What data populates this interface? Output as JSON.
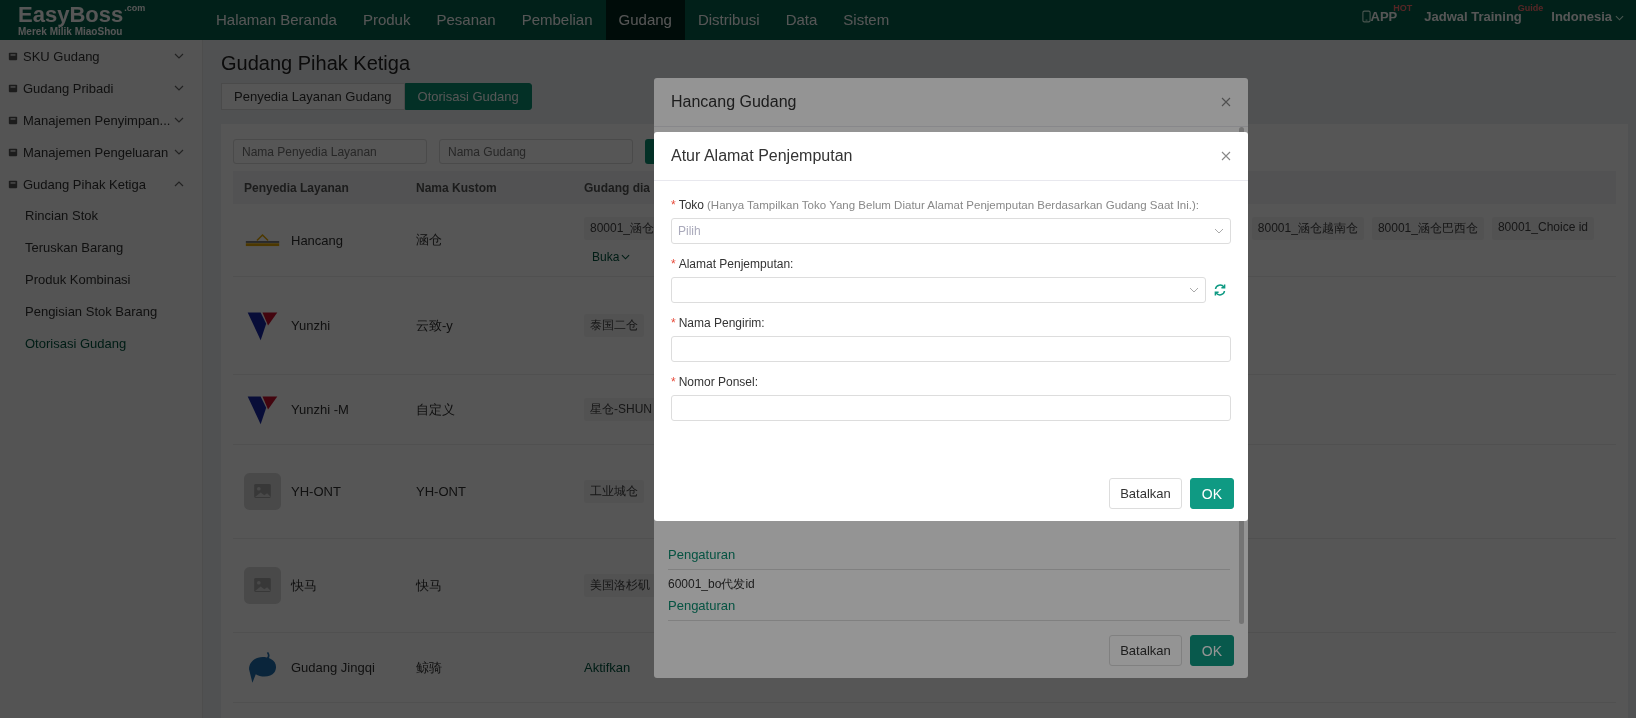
{
  "top_bar": {
    "logo": "EasyBoss",
    "logo_suffix": ".com",
    "tagline": "Merek Milik MiaoShou",
    "menu": [
      {
        "label": "Halaman Beranda",
        "selected": false
      },
      {
        "label": "Produk",
        "selected": false
      },
      {
        "label": "Pesanan",
        "selected": false
      },
      {
        "label": "Pembelian",
        "selected": false
      },
      {
        "label": "Gudang",
        "selected": true
      },
      {
        "label": "Distribusi",
        "selected": false
      },
      {
        "label": "Data",
        "selected": false
      },
      {
        "label": "Sistem",
        "selected": false
      }
    ],
    "app_link": "APP",
    "app_badge": "HOT",
    "training_link": "Jadwal Training",
    "training_badge": "Guide",
    "language": "Indonesia"
  },
  "sidebar": {
    "items": [
      {
        "label": "SKU Gudang",
        "expanded": false
      },
      {
        "label": "Gudang Pribadi",
        "expanded": false
      },
      {
        "label": "Manajemen Penyimpan...",
        "expanded": false
      },
      {
        "label": "Manajemen Pengeluaran",
        "expanded": false
      },
      {
        "label": "Gudang Pihak Ketiga",
        "expanded": true,
        "children": [
          {
            "label": "Rincian Stok",
            "selected": false
          },
          {
            "label": "Teruskan Barang",
            "selected": false
          },
          {
            "label": "Produk Kombinasi",
            "selected": false
          },
          {
            "label": "Pengisian Stok Barang",
            "selected": false
          },
          {
            "label": "Otorisasi Gudang",
            "selected": true
          }
        ]
      }
    ]
  },
  "page": {
    "title": "Gudang Pihak Ketiga",
    "tabs": [
      {
        "label": "Penyedia Layanan Gudang",
        "selected": false
      },
      {
        "label": "Otorisasi Gudang",
        "selected": true
      }
    ],
    "filters": [
      {
        "placeholder": "Nama Penyedia Layanan"
      },
      {
        "placeholder": "Nama Gudang"
      }
    ],
    "table": {
      "columns": [
        "Penyedia Layanan",
        "Nama Kustom",
        "Gudang dia"
      ],
      "rows": [
        {
          "kind": "hancang",
          "provider": "Hancang",
          "custom_name": "涵仓",
          "warehouses": [
            "80001_涵仓"
          ],
          "more_warehouses": [
            "80001_涵仓越南仓",
            "80001_涵仓巴西仓",
            "80001_Choice id"
          ],
          "toggle": "Buka"
        },
        {
          "kind": "yunzhi",
          "provider": "Yunzhi",
          "custom_name": "云致-y",
          "warehouses": [
            "泰国二仓"
          ]
        },
        {
          "kind": "yunzhi",
          "provider": "Yunzhi -M",
          "custom_name": "自定义",
          "warehouses": [
            "星仓-SHUN"
          ]
        },
        {
          "kind": "placeholder",
          "provider": "YH-ONT",
          "custom_name": "YH-ONT",
          "warehouses": [
            "工业城仓"
          ]
        },
        {
          "kind": "placeholder",
          "provider": "快马",
          "custom_name": "快马",
          "warehouses": [
            "美国洛杉矶"
          ]
        },
        {
          "kind": "whale",
          "provider": "Gudang Jingqi",
          "custom_name": "鲸骑",
          "action": "Aktifkan"
        }
      ]
    }
  },
  "warehouse_dialog": {
    "title": "Hancang Gudang",
    "items": [
      {
        "action": "Pengaturan"
      },
      {
        "label": "60001_bo代发id",
        "action": "Pengaturan"
      }
    ],
    "cancel": "Batalkan",
    "ok": "OK"
  },
  "pickup_dialog": {
    "title": "Atur Alamat Penjemputan",
    "required_mark": "*",
    "fields": [
      {
        "kind": "select",
        "label": "Toko",
        "hint": "(Hanya Tampilkan Toko Yang Belum Diatur Alamat Penjemputan Berdasarkan Gudang Saat Ini.):",
        "placeholder": "Pilih",
        "required": true
      },
      {
        "kind": "select_refresh",
        "label": "Alamat Penjemputan:",
        "required": true
      },
      {
        "kind": "input",
        "label": "Nama Pengirim:",
        "required": true
      },
      {
        "kind": "input",
        "label": "Nomor Ponsel:",
        "required": true
      }
    ],
    "cancel": "Batalkan",
    "ok": "OK"
  }
}
